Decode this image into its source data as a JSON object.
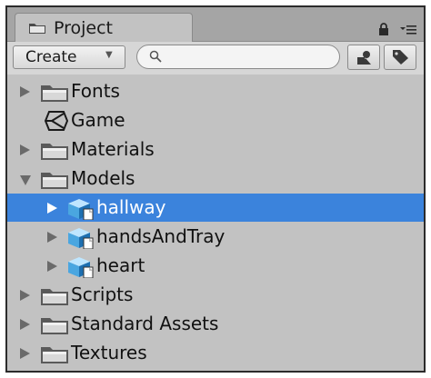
{
  "panel": {
    "tab_title": "Project",
    "create_label": "Create",
    "search_placeholder": "",
    "accent_selected": "#3b83dc"
  },
  "tree": {
    "items": [
      {
        "label": "Fonts",
        "icon": "folder-icon",
        "depth": 0,
        "arrow": "collapsed"
      },
      {
        "label": "Game",
        "icon": "unity-scene-icon",
        "depth": 0,
        "arrow": "none"
      },
      {
        "label": "Materials",
        "icon": "folder-icon",
        "depth": 0,
        "arrow": "collapsed"
      },
      {
        "label": "Models",
        "icon": "folder-icon",
        "depth": 0,
        "arrow": "expanded"
      },
      {
        "label": "hallway",
        "icon": "model-cube-icon",
        "depth": 1,
        "arrow": "collapsed",
        "selected": true
      },
      {
        "label": "handsAndTray",
        "icon": "model-cube-icon",
        "depth": 1,
        "arrow": "collapsed"
      },
      {
        "label": "heart",
        "icon": "model-cube-icon",
        "depth": 1,
        "arrow": "collapsed"
      },
      {
        "label": "Scripts",
        "icon": "folder-icon",
        "depth": 0,
        "arrow": "collapsed"
      },
      {
        "label": "Standard Assets",
        "icon": "folder-icon",
        "depth": 0,
        "arrow": "collapsed"
      },
      {
        "label": "Textures",
        "icon": "folder-icon",
        "depth": 0,
        "arrow": "collapsed"
      }
    ]
  }
}
